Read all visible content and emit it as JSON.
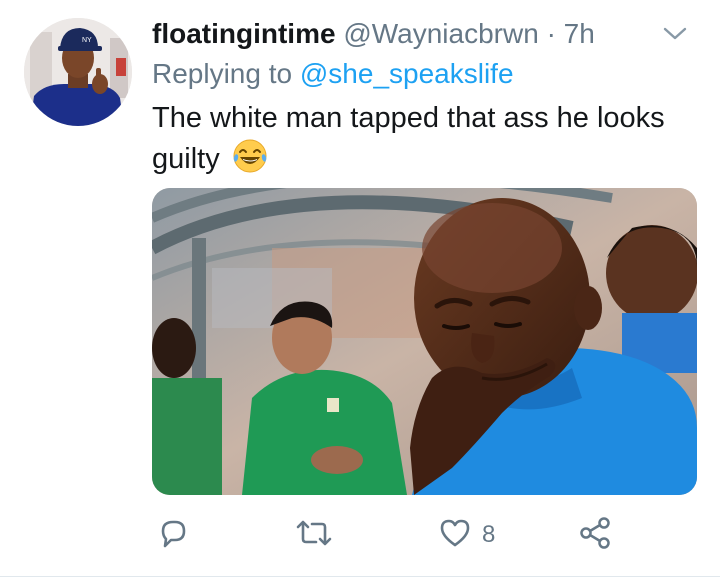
{
  "tweet": {
    "display_name": "floatingintime",
    "handle": "@Wayniacbrwn",
    "separator": "·",
    "time": "7h",
    "reply_prefix": "Replying to",
    "reply_handle": "@she_speakslife",
    "text": "The white man tapped that ass he looks guilty",
    "emoji_icon": "face-with-tears-of-joy-icon",
    "avatar_cap_text": "NY"
  },
  "actions": {
    "reply": {
      "icon": "reply-icon"
    },
    "retweet": {
      "icon": "retweet-icon"
    },
    "like": {
      "icon": "heart-icon",
      "count": "8"
    },
    "share": {
      "icon": "share-icon"
    }
  },
  "colors": {
    "name": "#14171a",
    "secondary": "#657786",
    "link": "#1da1f2",
    "icon": "#657786",
    "jersey_blue": "#1f8be0",
    "jersey_green": "#1f9a55"
  }
}
